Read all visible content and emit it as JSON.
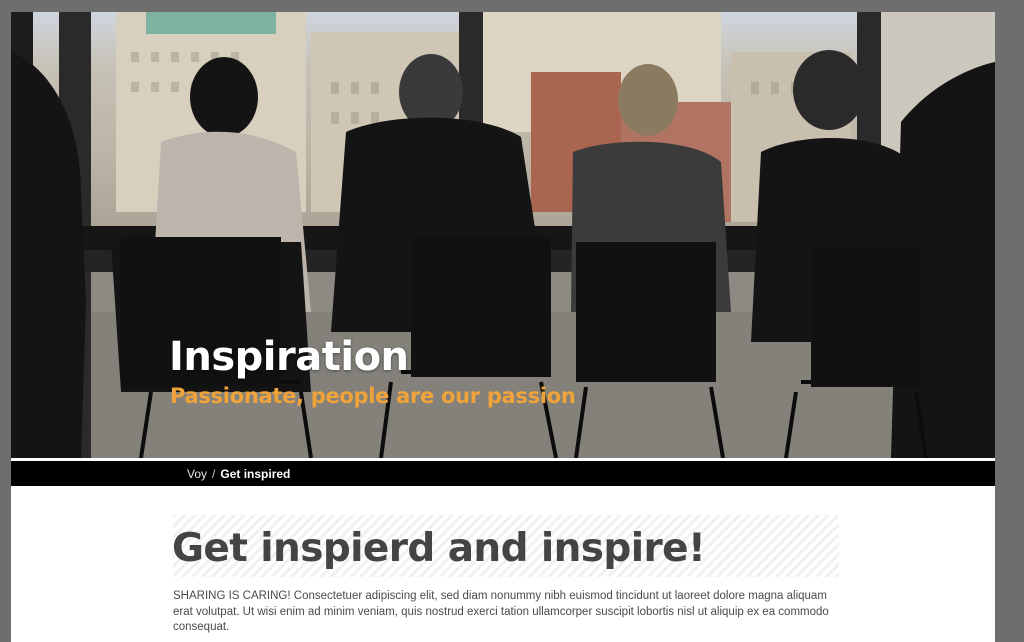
{
  "hero": {
    "title": "Inspiration",
    "subtitle": "Passionate, people are our passion",
    "accent_color": "#f0a33a"
  },
  "breadcrumb": {
    "home": "Voy",
    "separator": "/",
    "current": "Get inspired"
  },
  "content": {
    "heading": "Get inspierd and inspire!",
    "body": "SHARING IS CARING! Consectetuer adipiscing elit, sed diam nonummy nibh euismod tincidunt ut laoreet dolore magna aliquam erat volutpat. Ut wisi enim ad minim veniam, quis nostrud exerci tation ullamcorper suscipit lobortis nisl ut aliquip ex ea commodo consequat."
  }
}
